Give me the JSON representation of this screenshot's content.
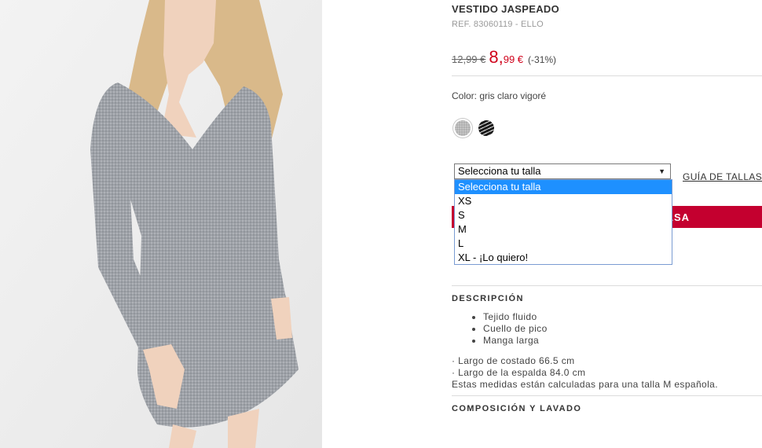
{
  "product": {
    "title": "VESTIDO JASPEADO",
    "reference": "REF. 83060119 - ELLO",
    "old_price": "12,99 €",
    "new_price_int": "8,",
    "new_price_dec": "99 €",
    "discount": "(-31%)"
  },
  "color": {
    "label": "Color: gris claro vigoré",
    "swatches": [
      {
        "name": "gris claro vigoré",
        "hex": "#a9a9a9",
        "selected": true
      },
      {
        "name": "negro",
        "hex": "#1a1a1a",
        "selected": false
      }
    ]
  },
  "size": {
    "selected": "Selecciona tu talla",
    "options": [
      "Selecciona tu talla",
      "XS",
      "S",
      "M",
      "L",
      "XL - ¡Lo quiero!"
    ],
    "highlighted_option": "Selecciona tu talla",
    "guide_link": "GUÍA DE TALLAS"
  },
  "add_to_bag": {
    "visible_label": "LSA",
    "color": "#c4002f"
  },
  "description": {
    "heading": "DESCRIPCIÓN",
    "bullets": [
      "Tejido fluido",
      "Cuello de pico",
      "Manga larga"
    ],
    "measures": [
      "· Largo de costado 66.5 cm",
      "· Largo de la espalda 84.0 cm",
      "Estas medidas están calculadas para una talla M española."
    ]
  },
  "composition": {
    "heading": "COMPOSICIÓN Y LAVADO"
  }
}
